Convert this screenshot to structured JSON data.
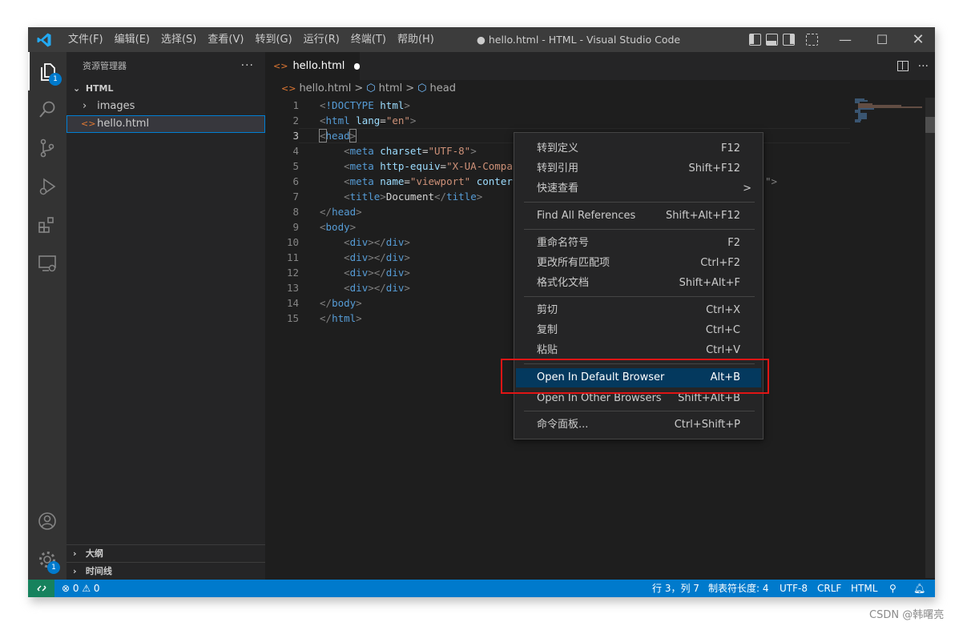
{
  "titlebar": {
    "menu": [
      "文件(F)",
      "编辑(E)",
      "选择(S)",
      "查看(V)",
      "转到(G)",
      "运行(R)",
      "终端(T)",
      "帮助(H)"
    ],
    "title": "● hello.html - HTML - Visual Studio Code"
  },
  "activity": {
    "explorer_badge": "1",
    "settings_badge": "1"
  },
  "sidebar": {
    "header": "资源管理器",
    "more": "···",
    "folder": "HTML",
    "items": [
      {
        "label": "images"
      },
      {
        "label": "hello.html"
      }
    ],
    "outline": "大纲",
    "timeline": "时间线"
  },
  "editor": {
    "tab_label": "hello.html",
    "breadcrumb": {
      "file": "hello.html",
      "sep": ">",
      "html": "html",
      "head": "head"
    },
    "line_numbers": [
      "1",
      "2",
      "3",
      "4",
      "5",
      "6",
      "7",
      "8",
      "9",
      "10",
      "11",
      "12",
      "13",
      "14",
      "15"
    ],
    "lines": [
      [
        {
          "c": "t-br",
          "t": "<"
        },
        {
          "c": "t-tag",
          "t": "!DOCTYPE"
        },
        {
          "c": "t-txt",
          "t": " "
        },
        {
          "c": "t-attr",
          "t": "html"
        },
        {
          "c": "t-br",
          "t": ">"
        }
      ],
      [
        {
          "c": "t-br",
          "t": "<"
        },
        {
          "c": "t-tag",
          "t": "html"
        },
        {
          "c": "t-txt",
          "t": " "
        },
        {
          "c": "t-attr",
          "t": "lang"
        },
        {
          "c": "t-txt",
          "t": "="
        },
        {
          "c": "t-str",
          "t": "\"en\""
        },
        {
          "c": "t-br",
          "t": ">"
        }
      ],
      [
        {
          "c": "t-br",
          "t": "<"
        },
        {
          "c": "t-tag",
          "t": "head"
        },
        {
          "c": "t-br",
          "t": ">"
        }
      ],
      [
        {
          "c": "t-txt",
          "t": "    "
        },
        {
          "c": "t-br",
          "t": "<"
        },
        {
          "c": "t-tag",
          "t": "meta"
        },
        {
          "c": "t-txt",
          "t": " "
        },
        {
          "c": "t-attr",
          "t": "charset"
        },
        {
          "c": "t-txt",
          "t": "="
        },
        {
          "c": "t-str",
          "t": "\"UTF-8\""
        },
        {
          "c": "t-br",
          "t": ">"
        }
      ],
      [
        {
          "c": "t-txt",
          "t": "    "
        },
        {
          "c": "t-br",
          "t": "<"
        },
        {
          "c": "t-tag",
          "t": "meta"
        },
        {
          "c": "t-txt",
          "t": " "
        },
        {
          "c": "t-attr",
          "t": "http-equiv"
        },
        {
          "c": "t-txt",
          "t": "="
        },
        {
          "c": "t-str",
          "t": "\"X-UA-Compa"
        }
      ],
      [
        {
          "c": "t-txt",
          "t": "    "
        },
        {
          "c": "t-br",
          "t": "<"
        },
        {
          "c": "t-tag",
          "t": "meta"
        },
        {
          "c": "t-txt",
          "t": " "
        },
        {
          "c": "t-attr",
          "t": "name"
        },
        {
          "c": "t-txt",
          "t": "="
        },
        {
          "c": "t-str",
          "t": "\"viewport\""
        },
        {
          "c": "t-txt",
          "t": " "
        },
        {
          "c": "t-attr",
          "t": "conter"
        }
      ],
      [
        {
          "c": "t-txt",
          "t": "    "
        },
        {
          "c": "t-br",
          "t": "<"
        },
        {
          "c": "t-tag",
          "t": "title"
        },
        {
          "c": "t-br",
          "t": ">"
        },
        {
          "c": "t-txt",
          "t": "Document"
        },
        {
          "c": "t-br",
          "t": "</"
        },
        {
          "c": "t-tag",
          "t": "title"
        },
        {
          "c": "t-br",
          "t": ">"
        }
      ],
      [
        {
          "c": "t-br",
          "t": "</"
        },
        {
          "c": "t-tag",
          "t": "head"
        },
        {
          "c": "t-br",
          "t": ">"
        }
      ],
      [
        {
          "c": "t-br",
          "t": "<"
        },
        {
          "c": "t-tag",
          "t": "body"
        },
        {
          "c": "t-br",
          "t": ">"
        }
      ],
      [
        {
          "c": "t-txt",
          "t": "    "
        },
        {
          "c": "t-br",
          "t": "<"
        },
        {
          "c": "t-tag",
          "t": "div"
        },
        {
          "c": "t-br",
          "t": "></"
        },
        {
          "c": "t-tag",
          "t": "div"
        },
        {
          "c": "t-br",
          "t": ">"
        }
      ],
      [
        {
          "c": "t-txt",
          "t": "    "
        },
        {
          "c": "t-br",
          "t": "<"
        },
        {
          "c": "t-tag",
          "t": "div"
        },
        {
          "c": "t-br",
          "t": "></"
        },
        {
          "c": "t-tag",
          "t": "div"
        },
        {
          "c": "t-br",
          "t": ">"
        }
      ],
      [
        {
          "c": "t-txt",
          "t": "    "
        },
        {
          "c": "t-br",
          "t": "<"
        },
        {
          "c": "t-tag",
          "t": "div"
        },
        {
          "c": "t-br",
          "t": "></"
        },
        {
          "c": "t-tag",
          "t": "div"
        },
        {
          "c": "t-br",
          "t": ">"
        }
      ],
      [
        {
          "c": "t-txt",
          "t": "    "
        },
        {
          "c": "t-br",
          "t": "<"
        },
        {
          "c": "t-tag",
          "t": "div"
        },
        {
          "c": "t-br",
          "t": "></"
        },
        {
          "c": "t-tag",
          "t": "div"
        },
        {
          "c": "t-br",
          "t": ">"
        }
      ],
      [
        {
          "c": "t-br",
          "t": "</"
        },
        {
          "c": "t-tag",
          "t": "body"
        },
        {
          "c": "t-br",
          "t": ">"
        }
      ],
      [
        {
          "c": "t-br",
          "t": "</"
        },
        {
          "c": "t-tag",
          "t": "html"
        },
        {
          "c": "t-br",
          "t": ">"
        }
      ]
    ],
    "line6_tail": "\">"
  },
  "context_menu": {
    "items": [
      {
        "label": "转到定义",
        "shortcut": "F12"
      },
      {
        "label": "转到引用",
        "shortcut": "Shift+F12"
      },
      {
        "label": "快速查看",
        "shortcut": ">"
      },
      {
        "label": "Find All References",
        "shortcut": "Shift+Alt+F12"
      },
      {
        "label": "重命名符号",
        "shortcut": "F2"
      },
      {
        "label": "更改所有匹配项",
        "shortcut": "Ctrl+F2"
      },
      {
        "label": "格式化文档",
        "shortcut": "Shift+Alt+F"
      },
      {
        "label": "剪切",
        "shortcut": "Ctrl+X"
      },
      {
        "label": "复制",
        "shortcut": "Ctrl+C"
      },
      {
        "label": "粘贴",
        "shortcut": "Ctrl+V"
      },
      {
        "label": "Open In Default Browser",
        "shortcut": "Alt+B"
      },
      {
        "label": "Open In Other Browsers",
        "shortcut": "Shift+Alt+B"
      },
      {
        "label": "命令面板...",
        "shortcut": "Ctrl+Shift+P"
      }
    ]
  },
  "statusbar": {
    "problems": "⊗ 0 ⚠ 0",
    "position": "行 3，列 7",
    "tabsize": "制表符长度: 4",
    "encoding": "UTF-8",
    "eol": "CRLF",
    "language": "HTML"
  },
  "watermark": "CSDN @韩曙亮",
  "colors": {
    "accent": "#007acc",
    "highlight": "#04395e",
    "redbox": "#e01515",
    "remote": "#16825d"
  }
}
